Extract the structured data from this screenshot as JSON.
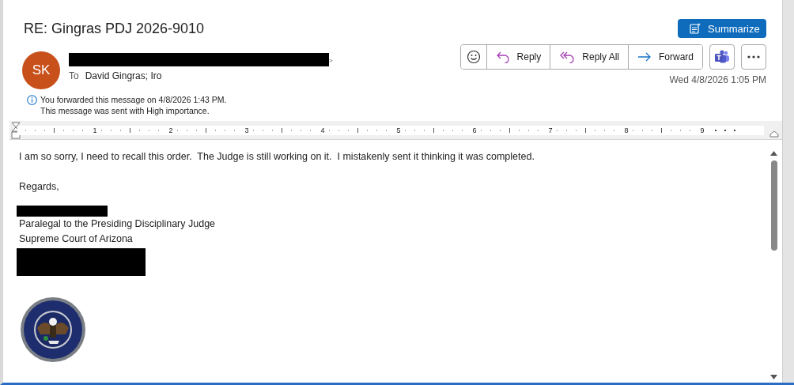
{
  "subject": "RE: Gingras PDJ 2026-9010",
  "sender": {
    "initials": "SK",
    "tail": ">",
    "to_label": "To",
    "to": "David Gingras; Iro"
  },
  "summarize": "Summarize",
  "actions": [
    {
      "kind": "emoji"
    },
    {
      "kind": "reply",
      "label": "Reply"
    },
    {
      "kind": "reply_all",
      "label": "Reply All"
    },
    {
      "kind": "forward",
      "label": "Forward"
    }
  ],
  "date": "Wed 4/8/2026 1:05 PM",
  "info": [
    "You forwarded this message on 4/8/2026 1:43 PM.",
    "This message was sent with High importance."
  ],
  "ruler": [
    "1",
    "2",
    "3",
    "4",
    "5",
    "6",
    "7",
    "8",
    "9"
  ],
  "body": {
    "message": "I am so sorry, I need to recall this order.  The Judge is still working on it.  I mistakenly sent it thinking it was completed.",
    "closing": "Regards,",
    "signature": [
      "Paralegal to the Presiding Disciplinary Judge",
      "Supreme Court of Arizona"
    ]
  }
}
